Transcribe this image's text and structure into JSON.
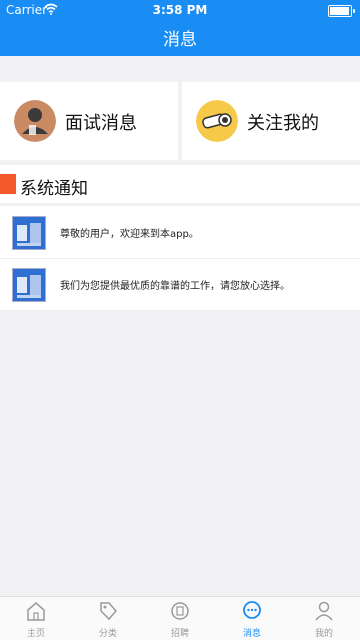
{
  "status_bar": {
    "carrier": "Carrier",
    "time": "3:58 PM"
  },
  "header": {
    "title": "消息"
  },
  "cards": [
    {
      "label": "面试消息",
      "icon": "person-suit-icon"
    },
    {
      "label": "关注我的",
      "icon": "telescope-icon"
    }
  ],
  "section": {
    "title": "系统通知"
  },
  "notifications": [
    {
      "text": "尊敬的用户，欢迎来到本app。",
      "thumb": "app-logo"
    },
    {
      "text": "我们为您提供最优质的靠谱的工作，请您放心选择。",
      "thumb": "app-logo"
    }
  ],
  "tabs": [
    {
      "label": "主页",
      "icon": "home-icon"
    },
    {
      "label": "分类",
      "icon": "tag-icon"
    },
    {
      "label": "招聘",
      "icon": "hire-icon"
    },
    {
      "label": "消息",
      "icon": "message-icon",
      "active": true
    },
    {
      "label": "我的",
      "icon": "profile-icon"
    }
  ],
  "colors": {
    "brand": "#1a8df5",
    "accent_red": "#f4592c",
    "tab_inactive": "#9a9a9a"
  }
}
